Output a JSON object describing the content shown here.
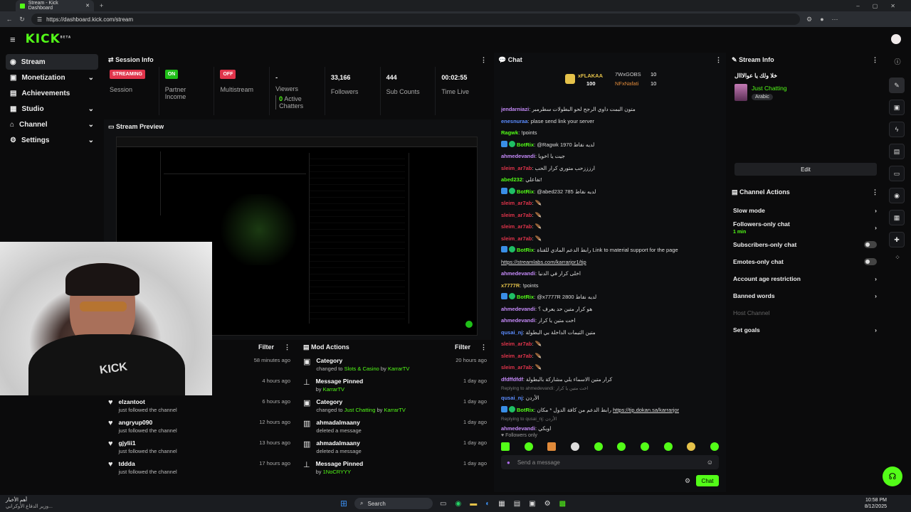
{
  "browser": {
    "tab_title": "Stream - Kick Dashboard",
    "url": "https://dashboard.kick.com/stream"
  },
  "header": {
    "logo": "KICK",
    "logo_sup": "BETA"
  },
  "sidebar": {
    "items": [
      {
        "label": "Stream",
        "icon": "broadcast-icon"
      },
      {
        "label": "Monetization",
        "icon": "monetization-icon"
      },
      {
        "label": "Achievements",
        "icon": "achievements-icon"
      },
      {
        "label": "Studio",
        "icon": "studio-icon"
      },
      {
        "label": "Channel",
        "icon": "channel-icon"
      },
      {
        "label": "Settings",
        "icon": "gear-icon"
      }
    ]
  },
  "session": {
    "title": "Session Info",
    "stats": [
      {
        "value": "STREAMING",
        "label": "Session"
      },
      {
        "value": "ON",
        "label": "Partner Income"
      },
      {
        "value": "OFF",
        "label": "Multistream"
      },
      {
        "value": "-",
        "label": "Viewers",
        "extra_count": "0",
        "extra": "Active Chatters"
      },
      {
        "value": "33,166",
        "label": "Followers"
      },
      {
        "value": "444",
        "label": "Sub Counts"
      },
      {
        "value": "00:02:55",
        "label": "Time Live"
      }
    ]
  },
  "preview": {
    "title": "Stream Preview"
  },
  "activity": {
    "filter": "Filter",
    "items": [
      {
        "user": "",
        "text": "",
        "time": "58 minutes ago"
      },
      {
        "user": "",
        "text": "",
        "time": "4 hours ago"
      },
      {
        "user": "elzantoot",
        "text": "just followed the channel",
        "time": "6 hours ago"
      },
      {
        "user": "angryup090",
        "text": "just followed the channel",
        "time": "12 hours ago"
      },
      {
        "user": "gjylii1",
        "text": "just followed the channel",
        "time": "13 hours ago"
      },
      {
        "user": "tddda",
        "text": "just followed the channel",
        "time": "17 hours ago"
      }
    ]
  },
  "mod_actions": {
    "title": "Mod Actions",
    "filter": "Filter",
    "items": [
      {
        "title": "Category",
        "pre": "changed to",
        "hl": "Slots & Casino",
        "mid": "by",
        "who": "KarrarTV",
        "time": "20 hours ago"
      },
      {
        "title": "Message Pinned",
        "pre": "by",
        "hl": "",
        "mid": "",
        "who": "KarrarTV",
        "time": "1 day ago"
      },
      {
        "title": "Category",
        "pre": "changed to",
        "hl": "Just Chatting",
        "mid": "by",
        "who": "KarrarTV",
        "time": "1 day ago"
      },
      {
        "title": "ahmadalmaany",
        "pre": "deleted a message",
        "hl": "",
        "mid": "",
        "who": "",
        "time": "1 day ago"
      },
      {
        "title": "ahmadalmaany",
        "pre": "deleted a message",
        "hl": "",
        "mid": "",
        "who": "",
        "time": "1 day ago"
      },
      {
        "title": "Message Pinned",
        "pre": "by",
        "hl": "",
        "mid": "",
        "who": "1NoCRYYY",
        "time": "1 day ago"
      }
    ]
  },
  "chat": {
    "title": "Chat",
    "leaders": [
      {
        "name": "xFLAKAA",
        "count": "100"
      },
      {
        "name": "7WxGOBS",
        "count": "10"
      },
      {
        "name": "NFxNafati",
        "count": "10"
      }
    ],
    "messages": [
      {
        "user": "jendarniazi",
        "color": "#c58af9",
        "text": "متون البمت داوي الرجح لحو البطولات سطرمبر",
        "bot": false
      },
      {
        "user": "enesnuraa",
        "color": "#5b8cff",
        "text": "plase send link your server",
        "bot": false
      },
      {
        "user": "Ragwk",
        "color": "#53fc18",
        "text": "!points",
        "bot": false
      },
      {
        "user": "BotRix",
        "color": "#53fc18",
        "text": "@Ragwk 1970 لديه نقاط",
        "bot": true
      },
      {
        "user": "ahmedevandi",
        "color": "#c58af9",
        "text": "جيت يا اخويا",
        "bot": false
      },
      {
        "user": "sleim_ar7ab",
        "color": "#e0344b",
        "text": "ارزززحب متوري كرار الحب",
        "bot": false
      },
      {
        "user": "abed232",
        "color": "#53fc18",
        "text": "تفاعلي!",
        "bot": false
      },
      {
        "user": "BotRix",
        "color": "#53fc18",
        "text": "@abed232 785 لديه نقاط",
        "bot": true
      },
      {
        "user": "sleim_ar7ab",
        "color": "#e0344b",
        "text": "🪶",
        "bot": false
      },
      {
        "user": "sleim_ar7ab",
        "color": "#e0344b",
        "text": "🪶",
        "bot": false
      },
      {
        "user": "sleim_ar7ab",
        "color": "#e0344b",
        "text": "🪶",
        "bot": false
      },
      {
        "user": "sleim_ar7ab",
        "color": "#e0344b",
        "text": "🪶",
        "bot": false
      },
      {
        "user": "BotRix",
        "color": "#53fc18",
        "text": "رابط الدعم المادي للقناة Link to material support for the page",
        "bot": true
      },
      {
        "user": "",
        "color": "#5b8cff",
        "text": "https://streamlabs.com/karrarjor1/tip",
        "bot": false,
        "link": true
      },
      {
        "user": "ahmedevandi",
        "color": "#c58af9",
        "text": "اخلى كرار في الدنيا",
        "bot": false
      },
      {
        "user": "x7777R",
        "color": "#e5c24a",
        "text": "!points",
        "bot": false
      },
      {
        "user": "BotRix",
        "color": "#53fc18",
        "text": "@x7777R 2800 لديه نقاط",
        "bot": true
      },
      {
        "user": "ahmedevandi",
        "color": "#c58af9",
        "text": "هو كرار متين حد يعرف ؟",
        "bot": false
      },
      {
        "user": "ahmedevandi",
        "color": "#c58af9",
        "text": "اخت متين يا كرار",
        "bot": false
      },
      {
        "user": "qusai_nj",
        "color": "#5b8cff",
        "text": "متين التيمات الداخلة بي البطولة",
        "bot": false
      },
      {
        "user": "sleim_ar7ab",
        "color": "#e0344b",
        "text": "🪶",
        "bot": false
      },
      {
        "user": "sleim_ar7ab",
        "color": "#e0344b",
        "text": "🪶",
        "bot": false
      },
      {
        "user": "sleim_ar7ab",
        "color": "#e0344b",
        "text": "🪶",
        "bot": false
      },
      {
        "user": "dfdffdfdf",
        "color": "#c58af9",
        "text": "كرار متين الاسماء يلي مشاركة بالبطولة",
        "bot": false
      }
    ],
    "reply1": "Replying to ahmedevandi: اخت متين يا كرار",
    "msg_after_reply1": {
      "user": "qusai_nj",
      "text": "الأردن"
    },
    "bot_tip": {
      "user": "BotRix",
      "text": "رابط الدعم من كافة الدول * مكان",
      "link": "https://tip.dokan.sa/karrarjor"
    },
    "reply2": "Replying to qusai_nj: الأردن",
    "msg_after_reply2": {
      "user": "ahmedevandi",
      "text": "اوبكي"
    },
    "followers_only": "Followers only",
    "placeholder": "Send a message",
    "send": "Chat"
  },
  "stream_info": {
    "title": "Stream Info",
    "stream_title": "خلا ولك يا عوالااال",
    "category": "Just Chatting",
    "language": "Arabic",
    "edit": "Edit"
  },
  "channel_actions": {
    "title": "Channel Actions",
    "items": [
      {
        "label": "Slow mode",
        "sub": "",
        "control": "chevron"
      },
      {
        "label": "Followers-only chat",
        "sub": "1 min",
        "control": "chevron"
      },
      {
        "label": "Subscribers-only chat",
        "sub": "",
        "control": "toggle"
      },
      {
        "label": "Emotes-only chat",
        "sub": "",
        "control": "toggle"
      },
      {
        "label": "Account age restriction",
        "sub": "",
        "control": "chevron"
      },
      {
        "label": "Banned words",
        "sub": "",
        "control": "chevron"
      },
      {
        "label": "Host Channel",
        "sub": "",
        "control": "none",
        "disabled": true
      },
      {
        "label": "Set goals",
        "sub": "",
        "control": "chevron"
      }
    ]
  },
  "taskbar": {
    "news_title": "أهم الأخبار",
    "news_sub": "وزير الدفاع الأوكراني...",
    "search": "Search",
    "time": "10:58 PM",
    "date": "8/12/2025"
  },
  "colors": {
    "accent": "#53fc18",
    "live_red": "#e0344b",
    "panel": "#0b0b0c"
  }
}
